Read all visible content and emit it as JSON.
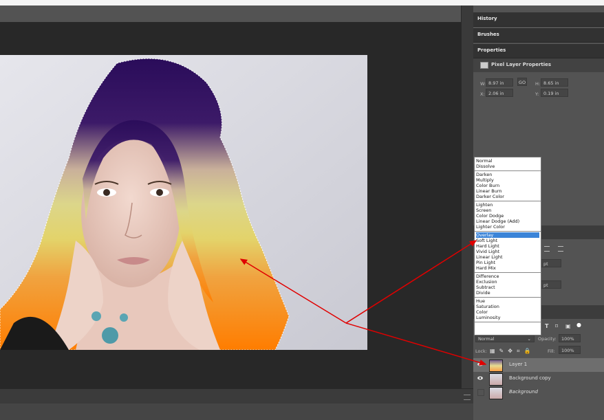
{
  "panels": {
    "history_tab": "History",
    "brushes_tab": "Brushes",
    "properties_tab": "Properties"
  },
  "properties": {
    "header": "Pixel Layer Properties",
    "w_label": "W:",
    "w_value": "8.97 in",
    "link_label": "GO",
    "h_label": "H:",
    "h_value": "8.65 in",
    "x_label": "X:",
    "x_value": "2.06 in",
    "y_label": "Y:",
    "y_value": "0.19 in"
  },
  "blend_modes": {
    "groups": [
      [
        "Normal",
        "Dissolve"
      ],
      [
        "Darken",
        "Multiply",
        "Color Burn",
        "Linear Burn",
        "Darker Color"
      ],
      [
        "Lighten",
        "Screen",
        "Color Dodge",
        "Linear Dodge (Add)",
        "Lighter Color"
      ],
      [
        "Overlay",
        "Soft Light",
        "Hard Light",
        "Vivid Light",
        "Linear Light",
        "Pin Light",
        "Hard Mix"
      ],
      [
        "Difference",
        "Exclusion",
        "Subtract",
        "Divide"
      ],
      [
        "Hue",
        "Saturation",
        "Color",
        "Luminosity"
      ]
    ],
    "selected": "Overlay"
  },
  "character": {
    "pt1": "pt",
    "pt2": "pt"
  },
  "layers_panel": {
    "filter_icons": [
      "T",
      "⌑",
      "▣",
      "●"
    ],
    "blend_value": "Normal",
    "opacity_label": "Opacity:",
    "opacity_value": "100%",
    "lock_label": "Lock:",
    "fill_label": "Fill:",
    "fill_value": "100%",
    "layers": [
      {
        "name": "Layer 1",
        "visible": true,
        "selected": true
      },
      {
        "name": "Background copy",
        "visible": true,
        "selected": false
      },
      {
        "name": "Background",
        "visible": false,
        "selected": false
      }
    ]
  },
  "colors": {
    "selection_highlight": "#3b84d8",
    "annotation_arrow": "#e00000",
    "panel_bg": "#535353"
  }
}
